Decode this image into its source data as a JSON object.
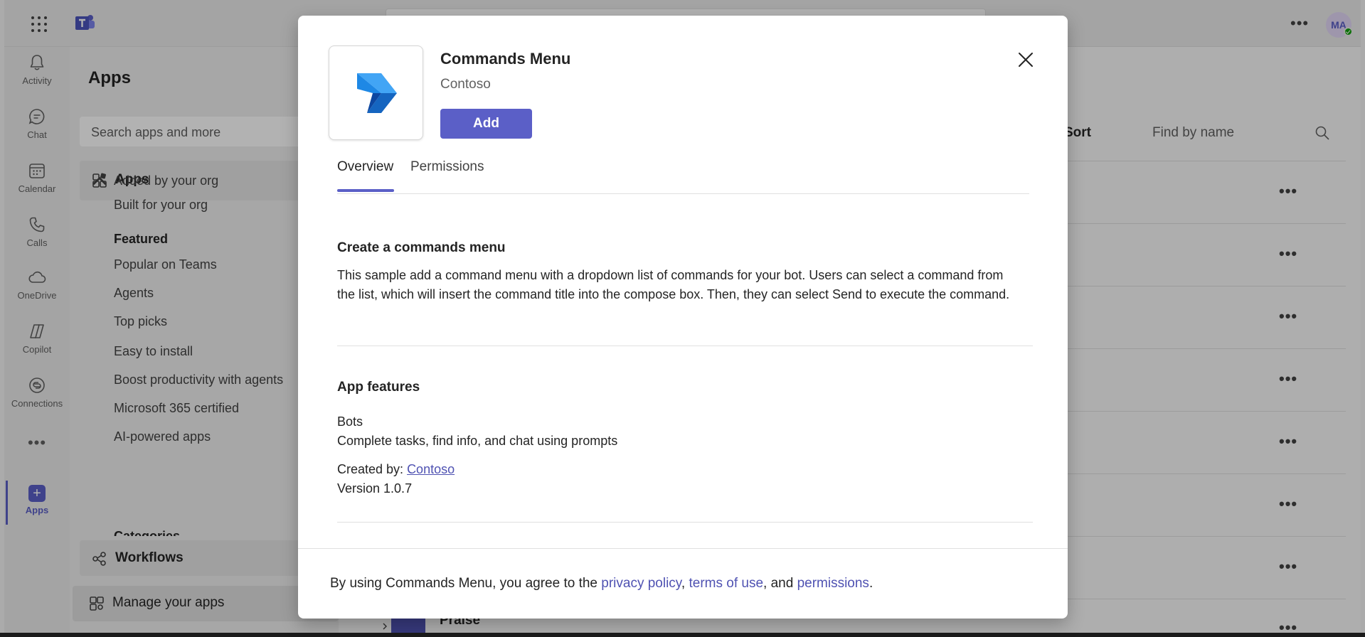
{
  "rail": {
    "items": [
      {
        "label": "Activity",
        "icon": "bell-icon"
      },
      {
        "label": "Chat",
        "icon": "chat-icon"
      },
      {
        "label": "Calendar",
        "icon": "calendar-icon"
      },
      {
        "label": "Calls",
        "icon": "phone-icon"
      },
      {
        "label": "OneDrive",
        "icon": "cloud-icon"
      },
      {
        "label": "Copilot",
        "icon": "copilot-icon"
      },
      {
        "label": "Connections",
        "icon": "connections-icon"
      }
    ],
    "more": "•••",
    "apps_label": "Apps",
    "apps_glyph": "+"
  },
  "header": {
    "more": "•••",
    "avatar_initials": "MA"
  },
  "apps_panel": {
    "title": "Apps",
    "search_placeholder": "Search apps and more",
    "group_label": "Apps",
    "items_top": [
      "Added by your org",
      "Built for your org"
    ],
    "featured_heading": "Featured",
    "featured_items": [
      "Popular on Teams",
      "Agents",
      "Top picks",
      "Easy to install",
      "Boost productivity with agents",
      "Microsoft 365 certified",
      "AI-powered apps"
    ],
    "cut_heading": "Categories",
    "workflows_label": "Workflows",
    "manage_label": "Manage your apps"
  },
  "main": {
    "sort_label": "Sort",
    "find_placeholder": "Find by name",
    "row_more": "•••",
    "praise_label": "Praise"
  },
  "dialog": {
    "app_name": "Commands Menu",
    "developer": "Contoso",
    "add_label": "Add",
    "tabs": [
      "Overview",
      "Permissions"
    ],
    "section1_title": "Create a commands menu",
    "section1_body": "This sample add a command menu with a dropdown list of commands for your bot. Users can select a command from the list, which will insert the command title into the compose box. Then, they can select Send to execute the command.",
    "section2_title": "App features",
    "feature_name": "Bots",
    "feature_desc": "Complete tasks, find info, and chat using prompts",
    "created_by_prefix": "Created by: ",
    "created_by_link": "Contoso",
    "version": "Version 1.0.7",
    "footer": {
      "prefix": "By using Commands Menu, you agree to the ",
      "privacy": "privacy policy",
      "comma": ", ",
      "terms": "terms of use",
      "and": ", and ",
      "permissions": "permissions",
      "period": "."
    }
  },
  "colors": {
    "accent": "#5b5fc7",
    "link": "#4f52b2",
    "presence": "#13a10e"
  }
}
